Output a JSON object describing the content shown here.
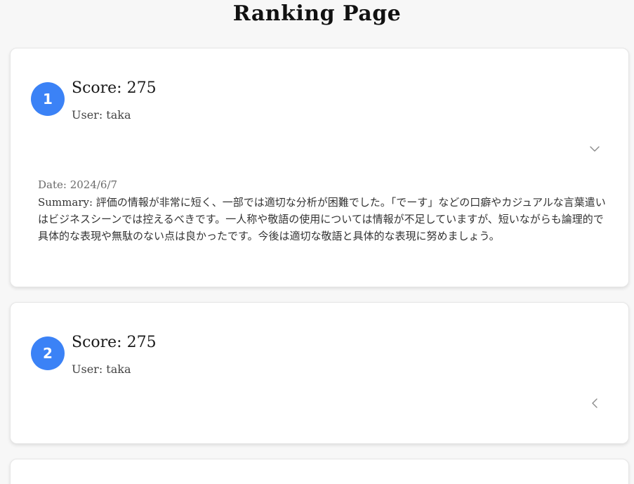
{
  "page": {
    "title": "Ranking Page",
    "accent_color": "#3b82f6"
  },
  "rankings": [
    {
      "rank": "1",
      "score": "Score: 275",
      "user": "User: taka",
      "expanded": true,
      "chevron_icon": "chevron-down-icon",
      "date": "Date: 2024/6/7",
      "summary": "Summary: 評価の情報が非常に短く、一部では適切な分析が困難でした。「でーす」などの口癖やカジュアルな言葉遣いはビジネスシーンでは控えるべきです。一人称や敬語の使用については情報が不足していますが、短いながらも論理的で具体的な表現や無駄のない点は良かったです。今後は適切な敬語と具体的な表現に努めましょう。"
    },
    {
      "rank": "2",
      "score": "Score: 275",
      "user": "User: taka",
      "expanded": false,
      "chevron_icon": "chevron-left-icon"
    }
  ]
}
